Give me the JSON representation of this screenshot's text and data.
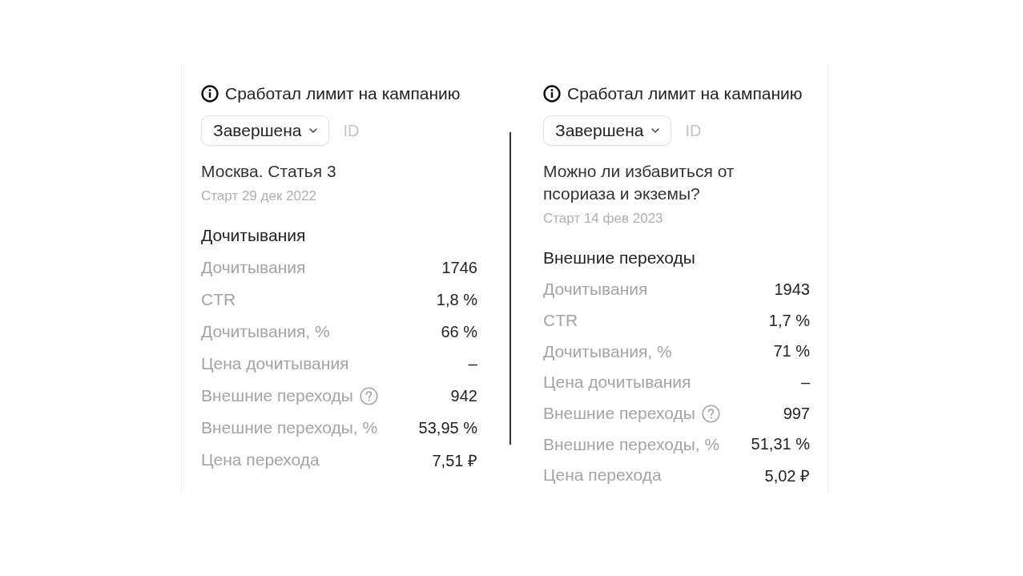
{
  "cards": [
    {
      "notice": "Сработал лимит на кампанию",
      "status": "Завершена",
      "id_label": "ID",
      "title": "Москва. Статья 3",
      "start": "Старт 29 дек 2022",
      "section": "Дочитывания",
      "metrics": [
        {
          "label": "Дочитывания",
          "value": "1746",
          "help": false
        },
        {
          "label": "CTR",
          "value": "1,8 %",
          "help": false
        },
        {
          "label": "Дочитывания, %",
          "value": "66 %",
          "help": false
        },
        {
          "label": "Цена дочитывания",
          "value": "–",
          "help": false
        },
        {
          "label": "Внешние переходы",
          "value": "942",
          "help": true
        },
        {
          "label": "Внешние переходы, %",
          "value": "53,95 %",
          "help": false
        },
        {
          "label": "Цена перехода",
          "value": "7,51 ₽",
          "help": false
        }
      ]
    },
    {
      "notice": "Сработал лимит на кампанию",
      "status": "Завершена",
      "id_label": "ID",
      "title": "Можно ли избавиться от псориаза и экземы?",
      "start": "Старт 14 фев 2023",
      "section": "Внешние переходы",
      "metrics": [
        {
          "label": "Дочитывания",
          "value": "1943",
          "help": false
        },
        {
          "label": "CTR",
          "value": "1,7 %",
          "help": false
        },
        {
          "label": "Дочитывания, %",
          "value": "71 %",
          "help": false
        },
        {
          "label": "Цена дочитывания",
          "value": "–",
          "help": false
        },
        {
          "label": "Внешние переходы",
          "value": "997",
          "help": true
        },
        {
          "label": "Внешние переходы, %",
          "value": "51,31 %",
          "help": false
        },
        {
          "label": "Цена перехода",
          "value": "5,02 ₽",
          "help": false
        }
      ]
    }
  ]
}
